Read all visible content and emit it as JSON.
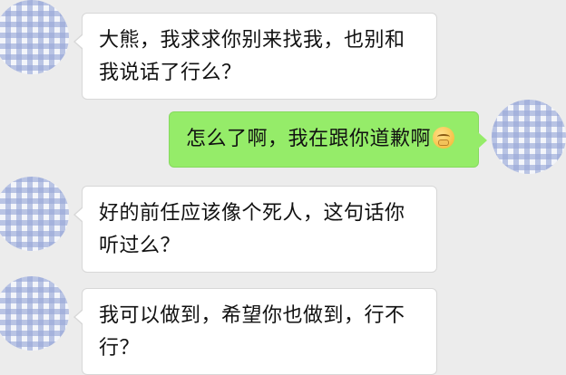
{
  "messages": [
    {
      "side": "left",
      "text": "大熊，我求求你别来找我，也别和我说话了行么？"
    },
    {
      "side": "right",
      "text": "怎么了啊，我在跟你道歉啊",
      "emoji": "pleading-face-emoji"
    },
    {
      "side": "left",
      "text": "好的前任应该像个死人，这句话你听过么？"
    },
    {
      "side": "left",
      "text": "我可以做到，希望你也做到，行不行？"
    }
  ]
}
